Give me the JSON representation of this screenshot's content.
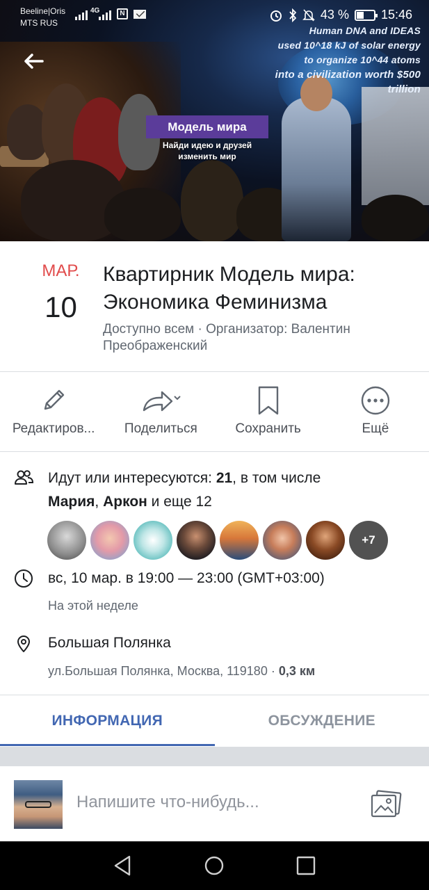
{
  "status_bar": {
    "carrier1": "Beeline|Oris",
    "carrier2": "MTS RUS",
    "network": "4G",
    "battery_level": "43 %",
    "battery_fraction": 0.43,
    "time": "15:46"
  },
  "cover": {
    "screen_line1": "Human DNA and IDEAS",
    "screen_line2": "used 10^18 kJ of solar energy",
    "screen_line3": "to organize 10^44 atoms",
    "screen_line4": "into a civilization worth $500 trillion",
    "banner_title": "Модель мира",
    "banner_sub": "Найди идею и друзей изменить мир",
    "back_icon": "back-arrow-icon"
  },
  "event": {
    "month": "МАР.",
    "day": "10",
    "title": "Квартирник Модель мира: Экономика Феминизма",
    "meta": "Доступно всем · Организатор: Валентин Преображенский"
  },
  "actions": {
    "edit": "Редактиров...",
    "share": "Поделиться",
    "save": "Сохранить",
    "more": "Ещё"
  },
  "details": {
    "going_prefix": "Идут или интересуются: ",
    "going_count": "21",
    "going_mid": ", в том числе",
    "friend1": "Мария",
    "separator": ", ",
    "friend2": "Аркон",
    "going_suffix": " и еще 12",
    "more_avatars": "+7",
    "time": "вс, 10 мар. в 19:00 — 23:00 (GMT+03:00)",
    "time_sub": "На этой неделе",
    "location": "Большая Полянка",
    "address": "ул.Большая Полянка, Москва, 119180 · ",
    "distance": "0,3 км"
  },
  "tabs": {
    "info": "ИНФОРМАЦИЯ",
    "discussion": "ОБСУЖДЕНИЕ"
  },
  "composer": {
    "placeholder": "Напишите что-нибудь..."
  },
  "colors": {
    "date_accent": "#e14b4b",
    "link_blue": "#4267b2",
    "banner_purple": "#5b3c9a"
  }
}
